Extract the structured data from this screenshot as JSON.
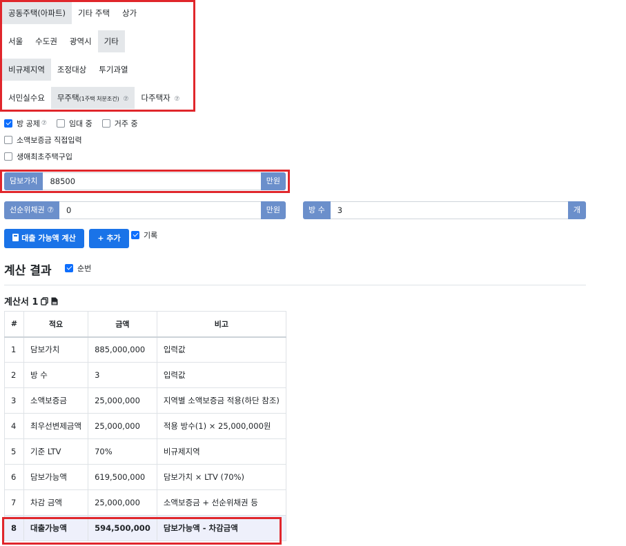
{
  "housing_type": {
    "options": [
      "공동주택(아파트)",
      "기타 주택",
      "상가"
    ],
    "selected": 0
  },
  "region": {
    "options": [
      "서울",
      "수도권",
      "광역시",
      "기타"
    ],
    "selected": 3
  },
  "regulation": {
    "options": [
      "비규제지역",
      "조정대상",
      "투기과열"
    ],
    "selected": 0
  },
  "buyer": {
    "opt1": "서민실수요",
    "opt2_main": "무주택",
    "opt2_small": "(1주택 처분조건)",
    "opt2_help": "⑦",
    "opt3": "다주택자",
    "opt3_help": "⑦",
    "selected": 1
  },
  "checks": {
    "room_deduction": {
      "label": "방 공제",
      "help": "⑦",
      "checked": true
    },
    "leasing": {
      "label": "임대 중",
      "checked": false
    },
    "residing": {
      "label": "거주 중",
      "checked": false
    },
    "manual_deposit": {
      "label": "소액보증금 직접입력",
      "checked": false
    },
    "first_home": {
      "label": "생애최초주택구입",
      "checked": false
    }
  },
  "collateral": {
    "label": "담보가치",
    "value": "88500",
    "unit": "만원"
  },
  "senior_lien": {
    "label": "선순위채권",
    "help": "⑦",
    "value": "0",
    "unit": "만원"
  },
  "rooms": {
    "label": "방 수",
    "value": "3",
    "unit": "개"
  },
  "buttons": {
    "calculate": "대출 가능액 계산",
    "add": "+ 추가",
    "record": "기록"
  },
  "results": {
    "title": "계산 결과",
    "order_label": "순번",
    "doc_title": "계산서 1"
  },
  "table": {
    "headers": [
      "#",
      "적요",
      "금액",
      "비고"
    ],
    "rows": [
      [
        "1",
        "담보가치",
        "885,000,000",
        "입력값"
      ],
      [
        "2",
        "방 수",
        "3",
        "입력값"
      ],
      [
        "3",
        "소액보증금",
        "25,000,000",
        "지역별 소액보증금 적용(하단 참조)"
      ],
      [
        "4",
        "최우선변제금액",
        "25,000,000",
        "적용 방수(1) × 25,000,000원"
      ],
      [
        "5",
        "기준 LTV",
        "70%",
        "비규제지역"
      ],
      [
        "6",
        "담보가능액",
        "619,500,000",
        "담보가치 × LTV (70%)"
      ],
      [
        "7",
        "차감 금액",
        "25,000,000",
        "소액보증금 + 선순위채권 등"
      ],
      [
        "8",
        "대출가능액",
        "594,500,000",
        "담보가능액 - 차감금액"
      ]
    ]
  },
  "colors": {
    "accent": "#1a73e8",
    "label_bg": "#6b8fcb",
    "highlight": "#e0262b"
  }
}
